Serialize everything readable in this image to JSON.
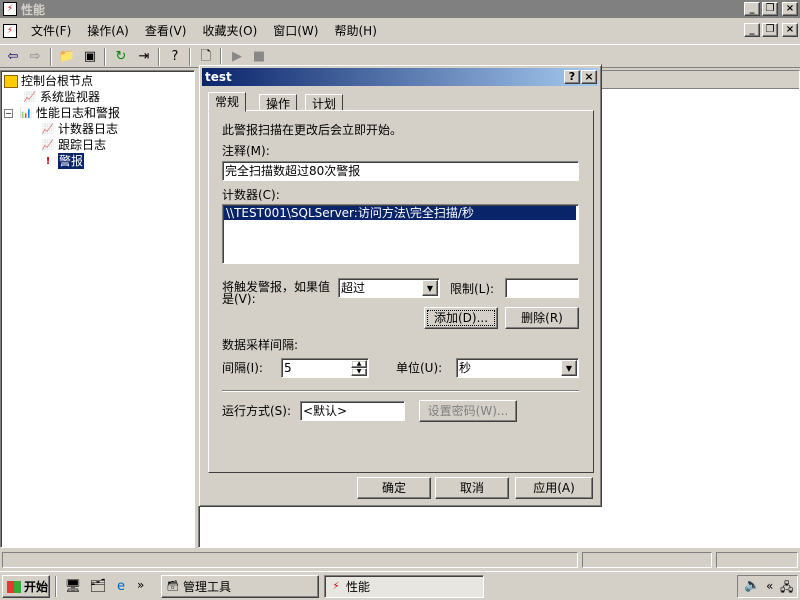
{
  "window": {
    "title": "性能"
  },
  "menu": [
    "文件(F)",
    "操作(A)",
    "查看(V)",
    "收藏夹(O)",
    "窗口(W)",
    "帮助(H)"
  ],
  "tree": {
    "root": "控制台根节点",
    "monitor": "系统监视器",
    "logs": "性能日志和警报",
    "counter_logs": "计数器日志",
    "trace_logs": "跟踪日志",
    "alerts": "警报"
  },
  "dialog": {
    "title": "test",
    "help_btn": "?",
    "close_btn": "×",
    "tabs": [
      "常规",
      "操作",
      "计划"
    ],
    "info": "此警报扫描在更改后会立即开始。",
    "comment_label": "注释(M):",
    "comment_value": "完全扫描数超过80次警报",
    "counters_label": "计数器(C):",
    "counters": [
      "\\\\TEST001\\SQLServer:访问方法\\完全扫描/秒"
    ],
    "trigger_label_1": "将触发警报，如果值",
    "trigger_label_2": "是(V):",
    "trigger_value": "超过",
    "limit_label": "限制(L):",
    "limit_value": "",
    "add_btn": "添加(D)...",
    "remove_btn": "删除(R)",
    "sample_label": "数据采样间隔:",
    "interval_label": "间隔(I):",
    "interval_value": "5",
    "unit_label": "单位(U):",
    "unit_value": "秒",
    "runas_label": "运行方式(S):",
    "runas_value": "<默认>",
    "password_btn": "设置密码(W)...",
    "ok_btn": "确定",
    "cancel_btn": "取消",
    "apply_btn": "应用(A)"
  },
  "taskbar": {
    "start": "开始",
    "quick_more": "»",
    "task1": "管理工具",
    "task2": "性能",
    "tray_more": "«"
  }
}
